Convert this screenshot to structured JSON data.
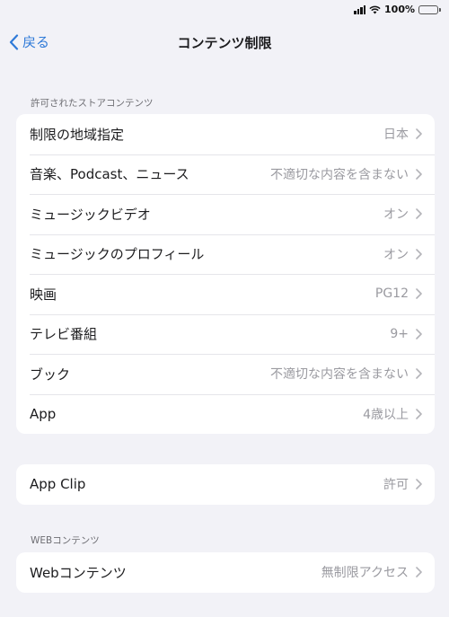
{
  "status": {
    "battery": "100%"
  },
  "nav": {
    "back_label": "戻る",
    "title": "コンテンツ制限"
  },
  "store_section": {
    "header": "許可されたストアコンテンツ",
    "rows": [
      {
        "label": "制限の地域指定",
        "value": "日本"
      },
      {
        "label": "音楽、Podcast、ニュース",
        "value": "不適切な内容を含まない"
      },
      {
        "label": "ミュージックビデオ",
        "value": "オン"
      },
      {
        "label": "ミュージックのプロフィール",
        "value": "オン"
      },
      {
        "label": "映画",
        "value": "PG12"
      },
      {
        "label": "テレビ番組",
        "value": "9+"
      },
      {
        "label": "ブック",
        "value": "不適切な内容を含まない"
      },
      {
        "label": "App",
        "value": "4歳以上"
      }
    ]
  },
  "appclip_section": {
    "rows": [
      {
        "label": "App Clip",
        "value": "許可"
      }
    ]
  },
  "web_section": {
    "header": "WEBコンテンツ",
    "rows": [
      {
        "label": "Webコンテンツ",
        "value": "無制限アクセス"
      }
    ]
  },
  "colors": {
    "accent": "#2f7ad8",
    "background": "#f2f2f7",
    "battery": "#4cd964"
  },
  "icons": [
    "signal-icon",
    "wifi-icon",
    "battery-icon",
    "back-chevron-icon",
    "chevron-right-icon"
  ]
}
